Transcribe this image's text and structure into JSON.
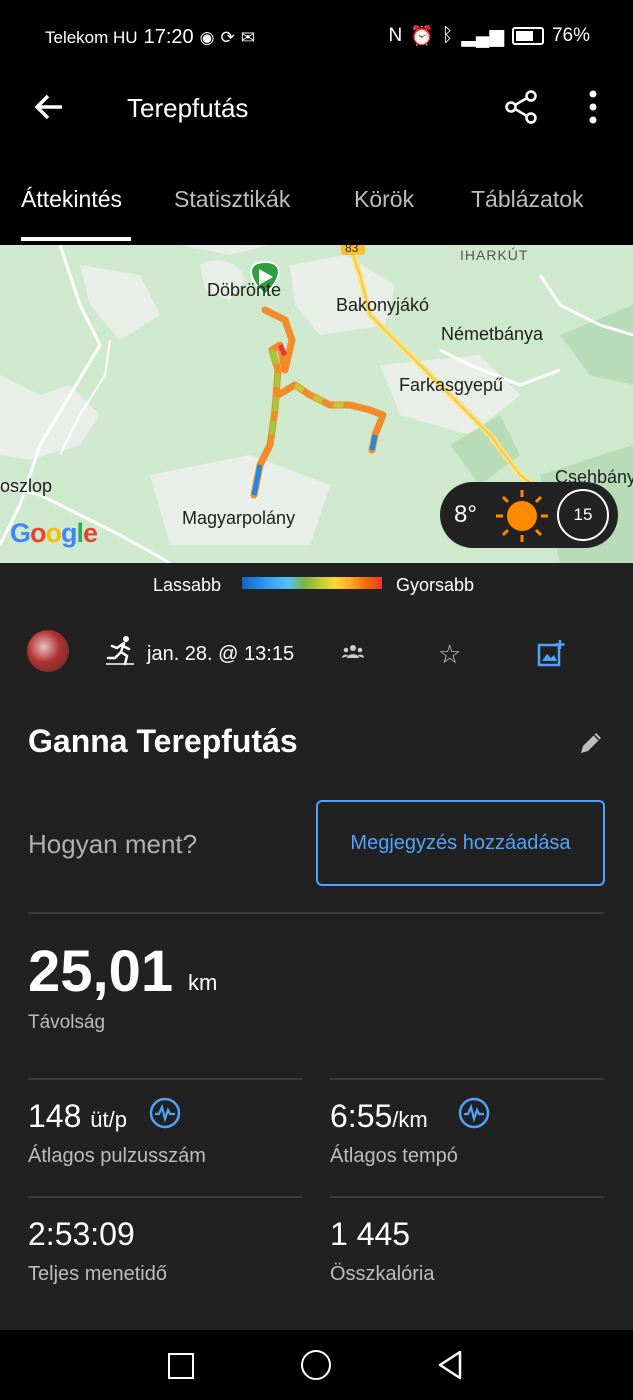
{
  "status_bar": {
    "carrier": "Telekom HU",
    "time": "17:20",
    "battery": "76%"
  },
  "appbar": {
    "title": "Terepfutás",
    "icons": [
      "arrow-back-icon",
      "share-icon",
      "more-vert-icon"
    ]
  },
  "tabs": [
    {
      "label": "Áttekintés",
      "active": true
    },
    {
      "label": "Statisztikák",
      "active": false
    },
    {
      "label": "Körök",
      "active": false
    },
    {
      "label": "Táblázatok",
      "active": false
    }
  ],
  "map": {
    "labels": [
      "Döbrönte",
      "Bakonyjákó",
      "Németbánya",
      "Farkasgyepű",
      "Csehbánya",
      "oszlop",
      "Magyarpolány",
      "IHARKÚT",
      "83"
    ],
    "attribution": "Google",
    "weather": {
      "temperature": "8°",
      "wind": "15"
    }
  },
  "legend": {
    "slow": "Lassabb",
    "fast": "Gyorsabb"
  },
  "meta": {
    "date": "jan. 28. @ 13:15"
  },
  "activity": {
    "name": "Ganna Terepfutás",
    "feel_prompt": "Hogyan ment?",
    "add_note": "Megjegyzés hozzáadása"
  },
  "distance": {
    "value": "25,01",
    "unit": "km",
    "label": "Távolság"
  },
  "stats": [
    {
      "value": "148",
      "unit": "üt/p",
      "label": "Átlagos pulzusszám"
    },
    {
      "value": "6:55",
      "unit": "/km",
      "label": "Átlagos tempó"
    },
    {
      "value": "2:53:09",
      "unit": "",
      "label": "Teljes menetidő"
    },
    {
      "value": "1 445",
      "unit": "",
      "label": "Összkalória"
    }
  ],
  "colors": {
    "accent": "#4fa3ff",
    "background": "#212121",
    "bar": "#000000",
    "map": "#cfe9cf"
  }
}
